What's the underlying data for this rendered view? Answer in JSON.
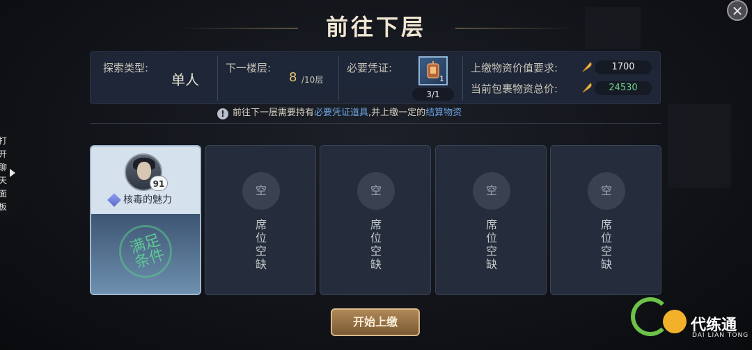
{
  "dialog": {
    "title": "前往下层",
    "close_icon": "close-icon"
  },
  "info": {
    "explore_type_label": "探索类型:",
    "explore_type_value": "单人",
    "next_floor_label": "下一楼层:",
    "next_floor_value": "8",
    "next_floor_total": "/10层",
    "voucher_label": "必要凭证:",
    "voucher_item_qty": "1",
    "voucher_count": "3/1",
    "submit_value_label": "上缴物资价值要求:",
    "submit_value": "1700",
    "bag_value_label": "当前包裹物资总价:",
    "bag_value": "24530",
    "bag_value_color": "#6fd18a",
    "coin_icon": "feather-coin-icon"
  },
  "notice": {
    "prefix": "前往下一层需要持有",
    "highlight1": "必要凭证道具",
    "middle": ",并上缴一定的",
    "highlight2": "结算物资",
    "highlight_color": "#6da5e6"
  },
  "side_tab": {
    "label": "打开聊天面板",
    "arrow_icon": "caret-right-icon"
  },
  "slots": [
    {
      "level": "91",
      "skill": "核毒的魅力",
      "stamp": "满足条件"
    },
    {
      "circle": "空",
      "text": "席位空缺"
    },
    {
      "circle": "空",
      "text": "席位空缺"
    },
    {
      "circle": "空",
      "text": "席位空缺"
    },
    {
      "circle": "空",
      "text": "席位空缺"
    }
  ],
  "start_button": "开始上缴",
  "brand": {
    "name": "代练通",
    "sub": "DAI LIAN TONG"
  }
}
